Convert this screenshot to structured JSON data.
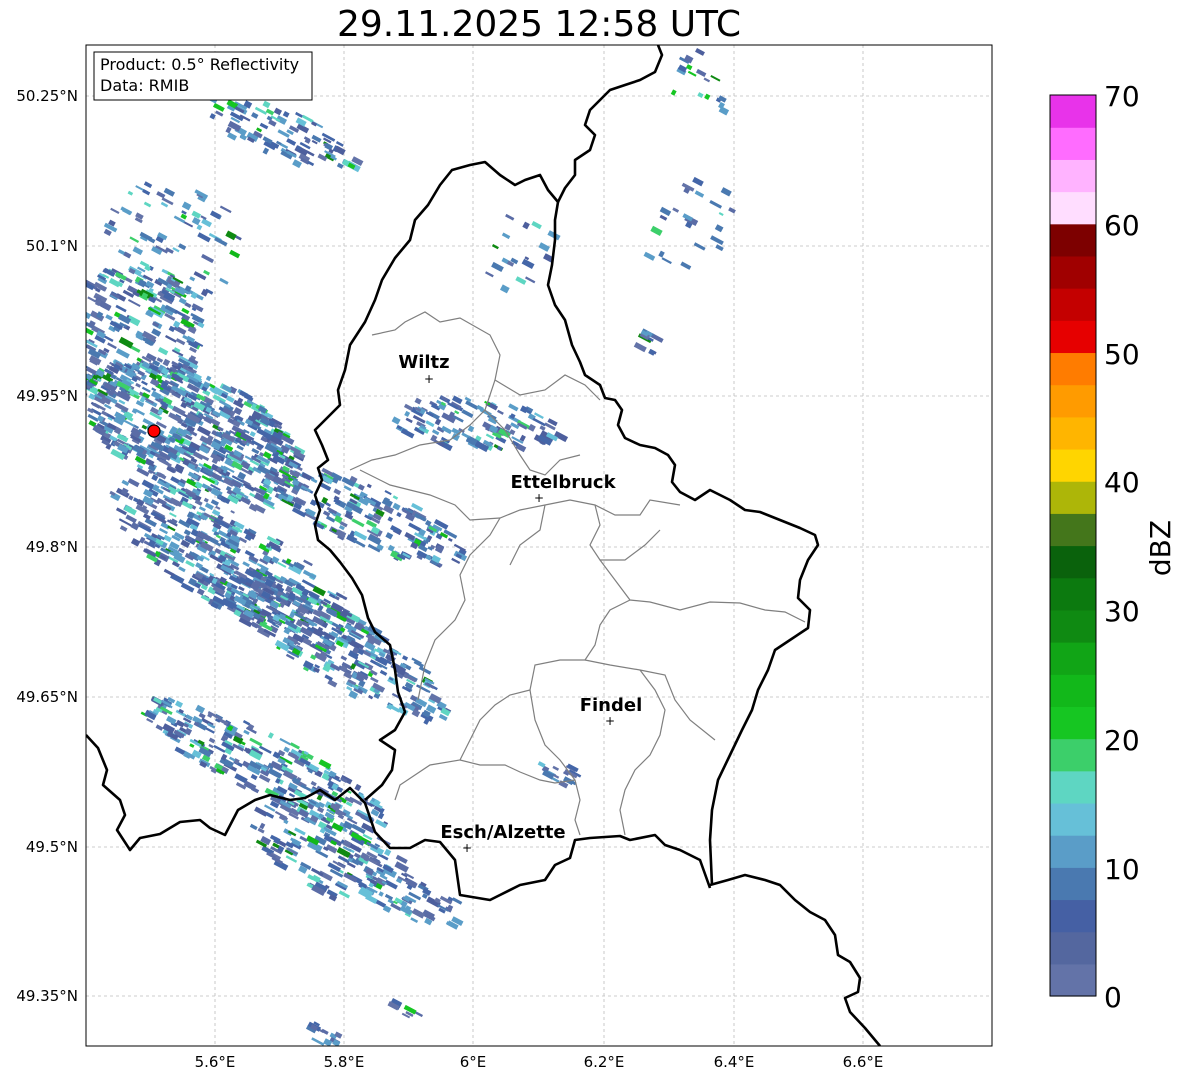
{
  "title": "29.11.2025 12:58 UTC",
  "info_box": {
    "line1": "Product: 0.5° Reflectivity",
    "line2": "Data: RMIB"
  },
  "x_ticks": [
    "5.6°E",
    "5.8°E",
    "6°E",
    "6.2°E",
    "6.4°E",
    "6.6°E"
  ],
  "y_ticks": [
    "50.25°N",
    "50.1°N",
    "49.95°N",
    "49.8°N",
    "49.65°N",
    "49.5°N",
    "49.35°N"
  ],
  "cities": [
    {
      "name": "Wiltz"
    },
    {
      "name": "Ettelbruck"
    },
    {
      "name": "Findel"
    },
    {
      "name": "Esch/Alzette"
    }
  ],
  "colorbar": {
    "label": "dBZ",
    "ticks": [
      "0",
      "10",
      "20",
      "30",
      "40",
      "50",
      "60",
      "70"
    ],
    "colors": [
      "#6373a8",
      "#54679f",
      "#4560a4",
      "#4a79b0",
      "#5a9dc8",
      "#66c0d8",
      "#5ed6c2",
      "#3ccf6a",
      "#16c622",
      "#12b81a",
      "#11a516",
      "#0f8a12",
      "#0c7a0f",
      "#0a620c",
      "#44761b",
      "#adb608",
      "#ffd500",
      "#ffb500",
      "#ff9b00",
      "#ff7c00",
      "#e60000",
      "#c40000",
      "#a00000",
      "#7d0000",
      "#ffddff",
      "#ffb3ff",
      "#ff6cff",
      "#e833ea"
    ]
  },
  "radar_site_color": "#ff0000"
}
